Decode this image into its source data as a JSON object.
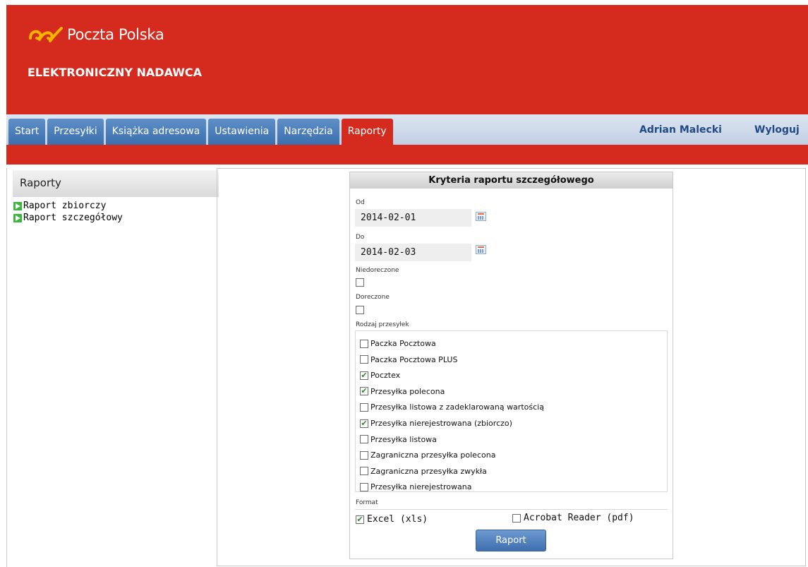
{
  "header": {
    "brand": "Poczta Polska",
    "app_title": "ELEKTRONICZNY NADAWCA",
    "brand_color": "#d52b1e",
    "logo_color": "#f5b400"
  },
  "nav": {
    "tabs": [
      {
        "label": "Start",
        "active": false
      },
      {
        "label": "Przesyłki",
        "active": false
      },
      {
        "label": "Książka adresowa",
        "active": false
      },
      {
        "label": "Ustawienia",
        "active": false
      },
      {
        "label": "Narzędzia",
        "active": false
      },
      {
        "label": "Raporty",
        "active": true
      }
    ],
    "user": "Adrian Malecki",
    "logout": "Wyloguj",
    "tab_color": "#3c6fae",
    "active_tab_color": "#d52b1e"
  },
  "sidebar": {
    "title": "Raporty",
    "items": [
      {
        "label": "Raport zbiorczy",
        "icon": "green-arrow-icon"
      },
      {
        "label": "Raport szczegółowy",
        "icon": "green-arrow-icon"
      }
    ]
  },
  "form": {
    "title": "Kryteria raportu szczegółowego",
    "from_label": "Od",
    "from_value": "2014-02-01",
    "to_label": "Do",
    "to_value": "2014-02-03",
    "undelivered_label": "Niedoreczone",
    "undelivered_checked": false,
    "delivered_label": "Doreczone",
    "delivered_checked": false,
    "types_label": "Rodzaj przesyłek",
    "types": [
      {
        "label": "Paczka Pocztowa",
        "checked": false
      },
      {
        "label": "Paczka Pocztowa PLUS",
        "checked": false
      },
      {
        "label": "Pocztex",
        "checked": true
      },
      {
        "label": "Przesyłka polecona",
        "checked": true
      },
      {
        "label": "Przesyłka listowa z zadeklarowaną wartością",
        "checked": false
      },
      {
        "label": "Przesyłka nierejestrowana (zbiorczo)",
        "checked": true
      },
      {
        "label": "Przesyłka listowa",
        "checked": false
      },
      {
        "label": "Zagraniczna przesyłka polecona",
        "checked": false
      },
      {
        "label": "Zagraniczna przesyłka zwykła",
        "checked": false
      },
      {
        "label": "Przesyłka nierejestrowana",
        "checked": false
      }
    ],
    "format_label": "Format",
    "formats": [
      {
        "label": "Excel (xls)",
        "checked": true
      },
      {
        "label": "Acrobat Reader (pdf)",
        "checked": false
      }
    ],
    "submit_label": "Raport"
  }
}
